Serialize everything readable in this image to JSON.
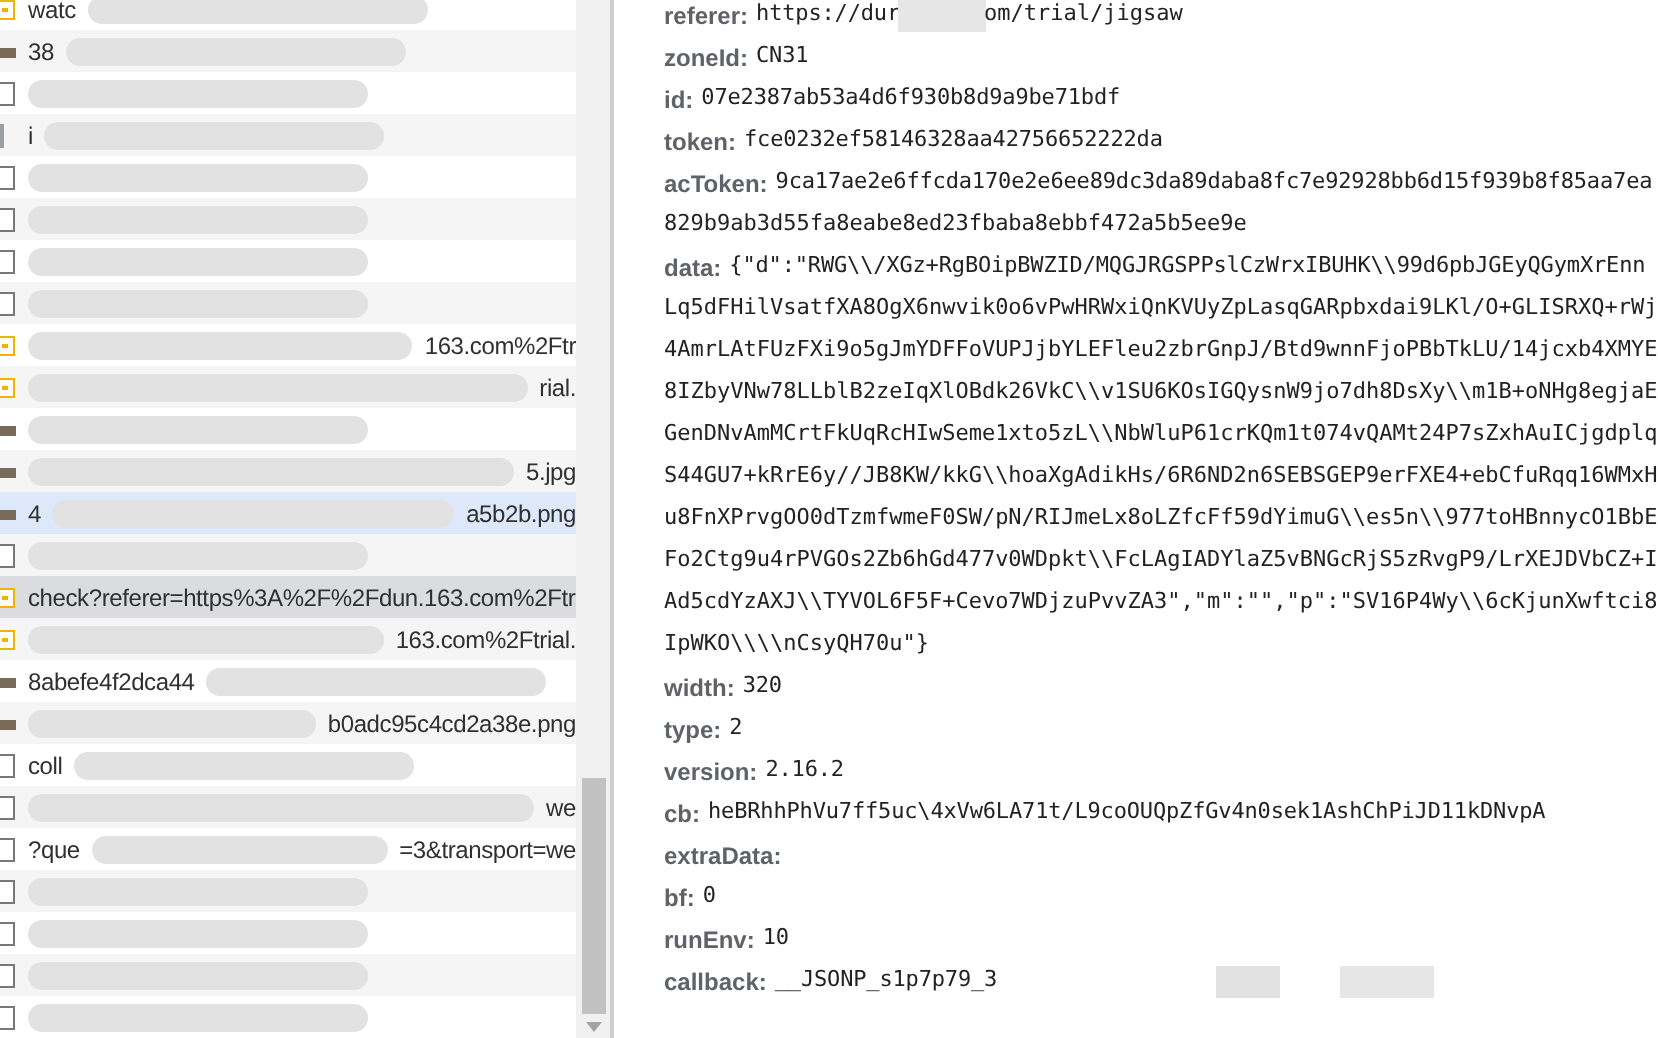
{
  "requests": [
    {
      "kind": "xhr",
      "prefix": "watc",
      "blur": true,
      "selected": false,
      "highlighted": false
    },
    {
      "kind": "image",
      "prefix": "38",
      "blur": true,
      "selected": false,
      "highlighted": false
    },
    {
      "kind": "doc",
      "blur": true,
      "selected": false,
      "highlighted": false
    },
    {
      "kind": "script",
      "prefix": "i",
      "blur": true,
      "selected": false,
      "highlighted": false
    },
    {
      "kind": "doc",
      "blur": true,
      "selected": false,
      "highlighted": false
    },
    {
      "kind": "doc",
      "blur": true,
      "selected": false,
      "highlighted": false
    },
    {
      "kind": "doc",
      "blur": true,
      "selected": false,
      "highlighted": false
    },
    {
      "kind": "doc",
      "blur": true,
      "selected": false,
      "highlighted": false
    },
    {
      "kind": "xhr",
      "blur": true,
      "suffix": "163.com%2Ftr",
      "selected": false,
      "highlighted": false
    },
    {
      "kind": "xhr",
      "blur": true,
      "suffix": "rial.",
      "selected": false,
      "highlighted": false
    },
    {
      "kind": "image",
      "blur": true,
      "selected": false,
      "highlighted": false
    },
    {
      "kind": "image",
      "blur": true,
      "suffix": "5.jpg",
      "selected": false,
      "highlighted": false
    },
    {
      "kind": "image",
      "prefix": "4",
      "blur": true,
      "suffix": "a5b2b.png",
      "selected": false,
      "highlighted": true
    },
    {
      "kind": "doc",
      "blur": true,
      "selected": false,
      "highlighted": false
    },
    {
      "kind": "xhr",
      "prefix": "check?referer=https%3A%2F%2Fdun.163.com%2Ftr",
      "blur": false,
      "selected": true,
      "highlighted": false
    },
    {
      "kind": "xhr",
      "blur": true,
      "suffix": "163.com%2Ftrial.",
      "selected": false,
      "highlighted": false
    },
    {
      "kind": "image",
      "prefix": "8abefe4f2dca44",
      "blur": true,
      "selected": false,
      "highlighted": false
    },
    {
      "kind": "image",
      "blur": true,
      "suffix": "b0adc95c4cd2a38e.png",
      "selected": false,
      "highlighted": false
    },
    {
      "kind": "doc",
      "prefix": "coll",
      "blur": true,
      "selected": false,
      "highlighted": false
    },
    {
      "kind": "doc",
      "blur": true,
      "suffix": "we",
      "selected": false,
      "highlighted": false
    },
    {
      "kind": "doc",
      "prefix": "?que",
      "blur": true,
      "suffix": "=3&transport=we",
      "selected": false,
      "highlighted": false
    },
    {
      "kind": "doc",
      "blur": true,
      "selected": false,
      "highlighted": false
    },
    {
      "kind": "doc",
      "blur": true,
      "selected": false,
      "highlighted": false
    },
    {
      "kind": "doc",
      "blur": true,
      "selected": false,
      "highlighted": false
    },
    {
      "kind": "doc",
      "blur": true,
      "selected": false,
      "highlighted": false
    }
  ],
  "params": [
    {
      "key": "referer:",
      "value": "https://dur",
      "blur": true,
      "suffix": "om/trial/jigsaw"
    },
    {
      "key": "zoneId:",
      "value": "CN31"
    },
    {
      "key": "id:",
      "value": "07e2387ab53a4d6f930b8d9a9be71bdf"
    },
    {
      "key": "token:",
      "value": "fce0232ef58146328aa42756652222da"
    },
    {
      "key": "acToken:",
      "value": "9ca17ae2e6ffcda170e2e6ee89dc3da89daba8fc7e92928bb6d15f939b8f85aa7ea",
      "lines": [
        "829b9ab3d55fa8eabe8ed23fbaba8ebbf472a5b5ee9e"
      ]
    },
    {
      "key": "data:",
      "value": "{\"d\":\"RWG\\\\/XGz+RgBOipBWZID/MQGJRGSPPslCzWrxIBUHK\\\\99d6pbJGEyQGymXrEnn",
      "lines": [
        "Lq5dFHilVsatfXA8OgX6nwvik0o6vPwHRWxiQnKVUyZpLasqGARpbxdai9LKl/O+GLISRXQ+rWj",
        "4AmrLAtFUzFXi9o5gJmYDFFoVUPJjbYLEFleu2zbrGnpJ/Btd9wnnFjoPBbTkLU/14jcxb4XMYE",
        "8IZbyVNw78LLblB2zeIqXlOBdk26VkC\\\\v1SU6KOsIGQysnW9jo7dh8DsXy\\\\m1B+oNHg8egjaE",
        "GenDNvAmMCrtFkUqRcHIwSeme1xto5zL\\\\NbWluP61crKQm1t074vQAMt24P7sZxhAuICjgdplq",
        "S44GU7+kRrE6y//JB8KW/kkG\\\\hoaXgAdikHs/6R6ND2n6SEBSGEP9erFXE4+ebCfuRqq16WMxH",
        "u8FnXPrvgOO0dTzmfwmeF0SW/pN/RIJmeLx8oLZfcFf59dYimuG\\\\es5n\\\\977toHBnnycO1BbE",
        "Fo2Ctg9u4rPVGOs2Zb6hGd477v0WDpkt\\\\FcLAgIADYlaZ5vBNGcRjS5zRvgP9/LrXEJDVbCZ+I",
        "Ad5cdYzAXJ\\\\TYVOL6F5F+Cevo7WDjzuPvvZA3\",\"m\":\"\",\"p\":\"SV16P4Wy\\\\6cKjunXwftci8",
        "IpWKO\\\\\\\\nCsyQH70u\"}"
      ]
    },
    {
      "key": "width:",
      "value": "320"
    },
    {
      "key": "type:",
      "value": "2"
    },
    {
      "key": "version:",
      "value": "2.16.2"
    },
    {
      "key": "cb:",
      "value": "heBRhhPhVu7ff5uc\\4xVw6LA71t/L9coOUQpZfGv4n0sek1AshChPiJD11kDNvpA"
    },
    {
      "key": "extraData:"
    },
    {
      "key": "bf:",
      "value": "0"
    },
    {
      "key": "runEnv:",
      "value": "10"
    },
    {
      "key": "callback:",
      "value": "__JSONP_s1p7p79_3",
      "trailing_blur": true
    }
  ]
}
